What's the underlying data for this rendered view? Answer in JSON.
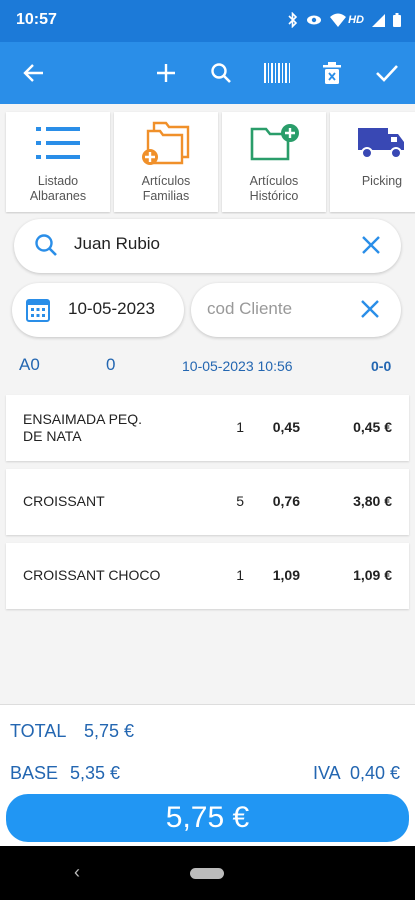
{
  "status_bar": {
    "time": "10:57",
    "hd_label": "HD",
    "icons": [
      "bluetooth-icon",
      "eye-icon",
      "wifi-icon",
      "signal-icon",
      "battery-icon"
    ]
  },
  "app_bar": {
    "actions": [
      "back-arrow-icon",
      "add-icon",
      "search-icon",
      "barcode-icon",
      "delete-icon",
      "check-icon"
    ]
  },
  "tiles": [
    {
      "label": "Listado\nAlbaranes",
      "icon": "list-icon"
    },
    {
      "label": "Artículos\nFamilias",
      "icon": "folders-add-icon"
    },
    {
      "label": "Artículos\nHistórico",
      "icon": "folder-add-icon"
    },
    {
      "label": "Picking",
      "icon": "truck-icon"
    }
  ],
  "search": {
    "value": "Juan Rubio"
  },
  "date": {
    "value": "10-05-2023"
  },
  "client": {
    "placeholder": "cod Cliente"
  },
  "document": {
    "series": "A0",
    "number": "0",
    "datetime": "10-05-2023 10:56",
    "code": "0-0"
  },
  "lines": [
    {
      "description": "ENSAIMADA PEQ.\nDE NATA",
      "qty": "1",
      "price": "0,45",
      "total": "0,45 €"
    },
    {
      "description": "CROISSANT",
      "qty": "5",
      "price": "0,76",
      "total": "3,80 €"
    },
    {
      "description": "CROISSANT CHOCO",
      "qty": "1",
      "price": "1,09",
      "total": "1,09 €"
    }
  ],
  "totals": {
    "total_label": "TOTAL",
    "total_value": "5,75 €",
    "base_label": "BASE",
    "base_value": "5,35 €",
    "iva_label": "IVA",
    "iva_value": "0,40 €",
    "button_value": "5,75 €"
  },
  "colors": {
    "primary": "#2a8ee8",
    "status_bar": "#1c7ad8",
    "accent_orange": "#f0902a",
    "accent_green": "#2a9d6a",
    "truck": "#3948b4",
    "text_blue": "#2366b1",
    "button": "#2196f3"
  }
}
